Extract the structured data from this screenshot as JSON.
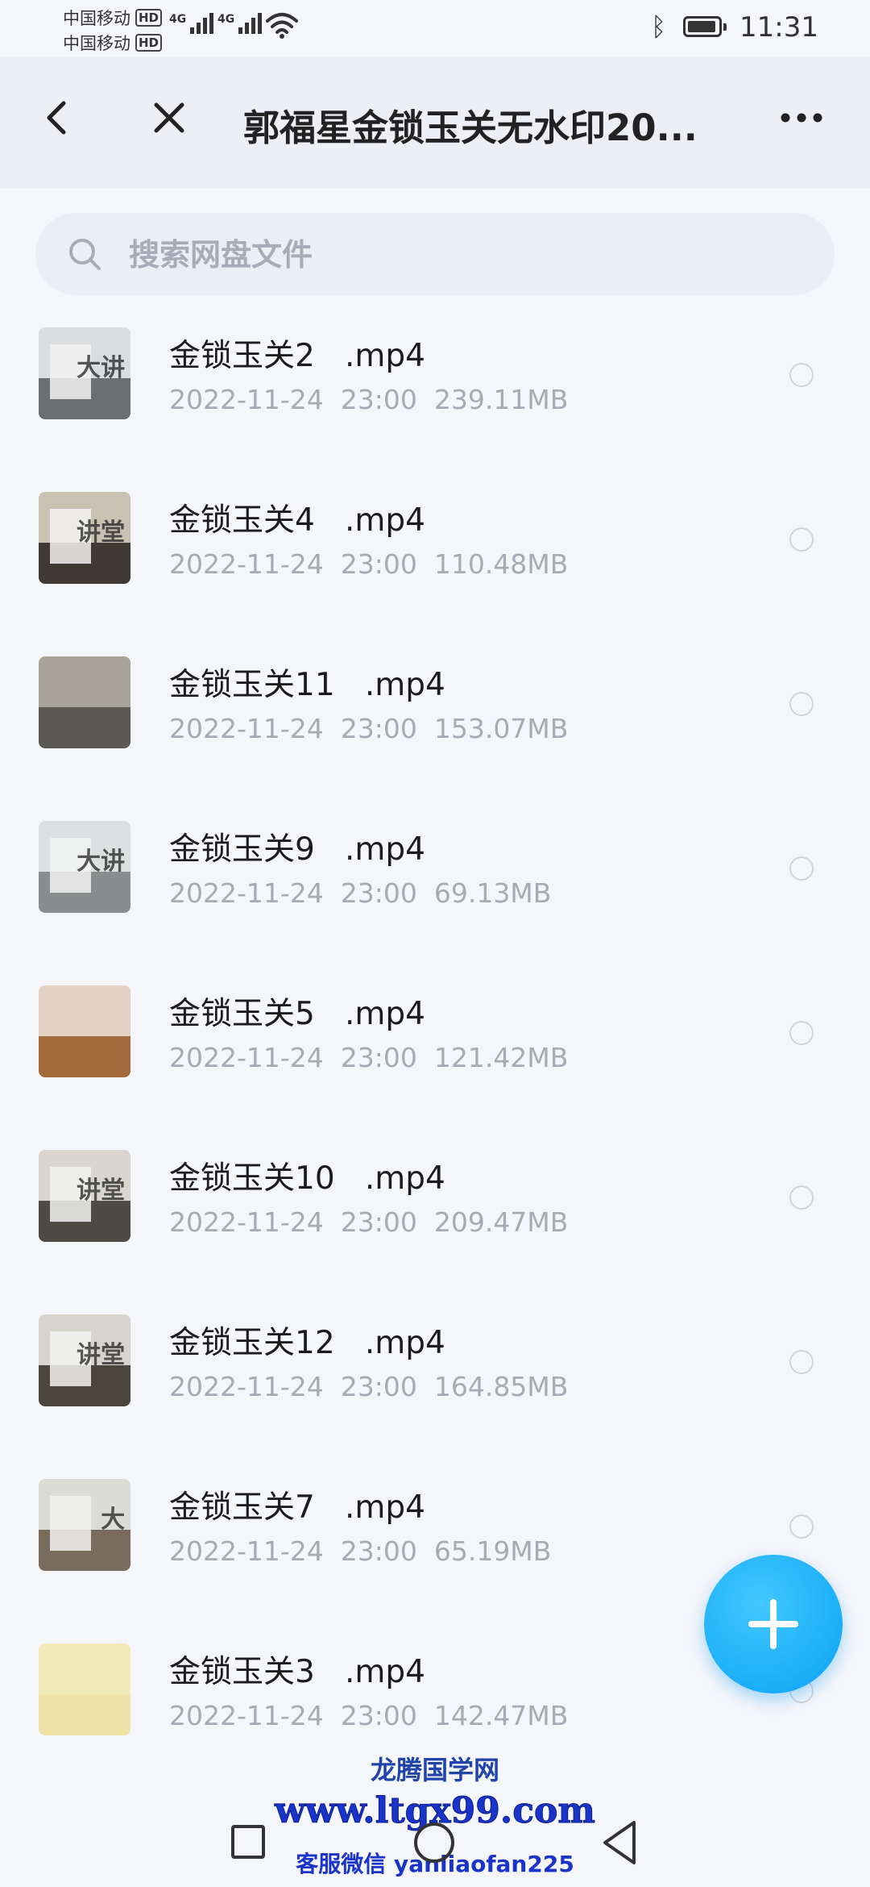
{
  "status_bar": {
    "carrier1": "中国移动",
    "carrier2": "中国移动",
    "hd": "HD",
    "net": "4G",
    "time": "11:31",
    "battery_level": 0.9
  },
  "header": {
    "title": "郭福星金锁玉关无水印20..."
  },
  "search": {
    "placeholder": "搜索网盘文件"
  },
  "files": [
    {
      "name": "金锁玉关2   .mp4",
      "meta": "2022-11-24  23:00  239.11MB",
      "thumb": {
        "top": "#d9dde0",
        "bottom": "#6b6f70",
        "board": true,
        "text": "大讲"
      }
    },
    {
      "name": "金锁玉关4   .mp4",
      "meta": "2022-11-24  23:00  110.48MB",
      "thumb": {
        "top": "#c9c2b2",
        "bottom": "#3e3a33",
        "board": true,
        "text": "讲堂"
      }
    },
    {
      "name": "金锁玉关11   .mp4",
      "meta": "2022-11-24  23:00  153.07MB",
      "thumb": {
        "top": "#a9a49a",
        "bottom": "#5a5a52",
        "board": false,
        "text": ""
      }
    },
    {
      "name": "金锁玉关9   .mp4",
      "meta": "2022-11-24  23:00  69.13MB",
      "thumb": {
        "top": "#dde0e0",
        "bottom": "#8a8d8e",
        "board": true,
        "text": "大讲"
      }
    },
    {
      "name": "金锁玉关5   .mp4",
      "meta": "2022-11-24  23:00  121.42MB",
      "thumb": {
        "top": "#e3d2c2",
        "bottom": "#a36a3c",
        "board": false,
        "text": ""
      }
    },
    {
      "name": "金锁玉关10   .mp4",
      "meta": "2022-11-24  23:00  209.47MB",
      "thumb": {
        "top": "#d8d6cf",
        "bottom": "#4e4a44",
        "board": true,
        "text": "讲堂"
      }
    },
    {
      "name": "金锁玉关12   .mp4",
      "meta": "2022-11-24  23:00  164.85MB",
      "thumb": {
        "top": "#d6d4cd",
        "bottom": "#4a463e",
        "board": true,
        "text": "讲堂"
      }
    },
    {
      "name": "金锁玉关7   .mp4",
      "meta": "2022-11-24  23:00  65.19MB",
      "thumb": {
        "top": "#dcdcd6",
        "bottom": "#7a6c5c",
        "board": true,
        "text": "大"
      }
    },
    {
      "name": "金锁玉关3   .mp4",
      "meta": "2022-11-24  23:00  142.47MB",
      "thumb": {
        "top": "#f2e9b8",
        "bottom": "#efe3a8",
        "board": false,
        "text": ""
      }
    }
  ],
  "fab": {
    "icon": "plus-icon"
  },
  "watermark": {
    "line1": "龙腾国学网",
    "line2": "www.ltgx99.com",
    "line3": "客服微信 yanliaofan225"
  },
  "colors": {
    "accent": "#0aa3f5",
    "background": "#f5f6fa",
    "header_bg": "#eeeff4",
    "meta_text": "#a8abb5"
  }
}
